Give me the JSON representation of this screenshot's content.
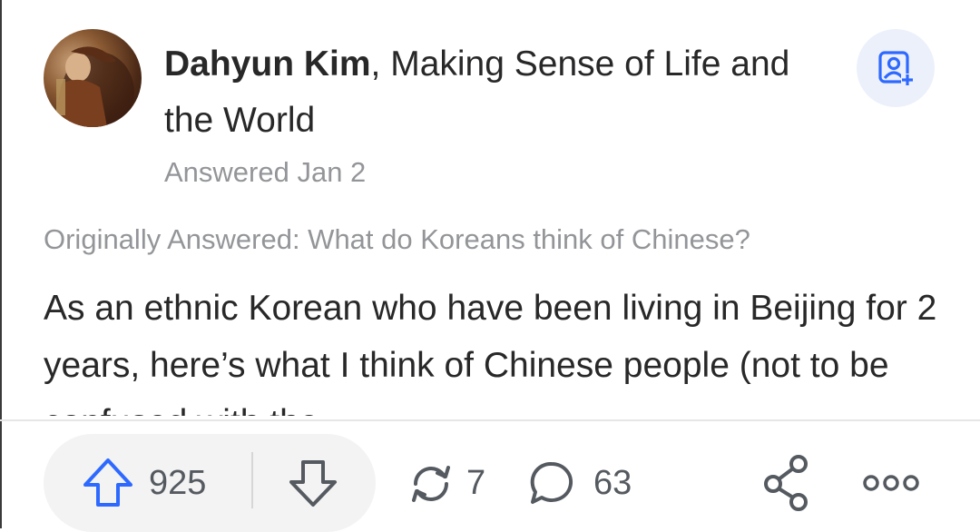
{
  "author": {
    "name": "Dahyun Kim",
    "credential": ", Making Sense of Life and the World",
    "answered": "Answered Jan 2",
    "avatar_icon": "profile-photo"
  },
  "follow": {
    "icon": "add-person-icon"
  },
  "question": {
    "originally_answered": "Originally Answered: What do Koreans think of Chinese?"
  },
  "answer": {
    "text": "As an ethnic Korean who have been living in Beijing for 2 years, here’s what I think of Chinese people (not to be confused with the"
  },
  "actions": {
    "upvotes": "925",
    "shares": "7",
    "comments": "63",
    "icons": [
      "upvote-arrow-icon",
      "downvote-arrow-icon",
      "share-cycle-icon",
      "comment-bubble-icon",
      "share-link-icon",
      "more-dots-icon"
    ]
  },
  "colors": {
    "primary_text": "#282829",
    "secondary_text": "#939598",
    "accent_blue": "#2e69ff",
    "action_gray": "#555a60"
  }
}
